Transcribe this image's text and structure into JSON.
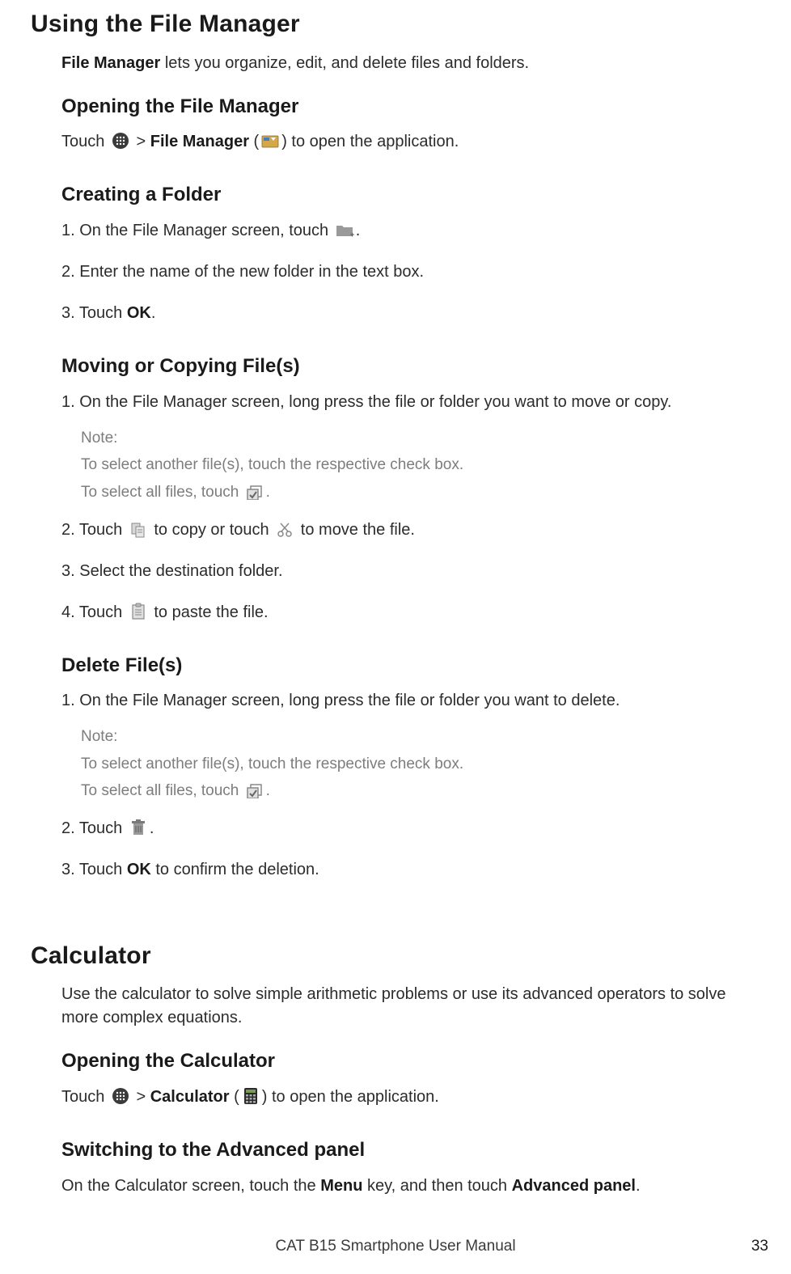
{
  "headings": {
    "using_file_manager": "Using the File Manager",
    "opening_file_manager": "Opening the File Manager",
    "creating_folder": "Creating a Folder",
    "moving_copying": "Moving or Copying File(s)",
    "delete_files": "Delete File(s)",
    "calculator": "Calculator",
    "opening_calculator": "Opening the Calculator",
    "switching_advanced": "Switching to the Advanced panel"
  },
  "text": {
    "fm_intro_1": "File Manager",
    "fm_intro_2": " lets you organize, edit, and delete files and folders.",
    "open_fm_1": "Touch ",
    "open_fm_2": " > ",
    "open_fm_3": "File Manager",
    "open_fm_4": " (",
    "open_fm_5": ") to open the application.",
    "create_step1_a": "1. On the File Manager screen, touch ",
    "create_step1_b": ".",
    "create_step2": "2. Enter the name of the new folder in the text box.",
    "create_step3_a": "3. Touch ",
    "create_step3_b": "OK",
    "create_step3_c": ".",
    "move_step1": "1. On the File Manager screen, long press the file or folder you want to move or copy.",
    "note_label": "Note:",
    "note_line1": "To select another file(s), touch the respective check box.",
    "note_line2_a": "To select all files, touch ",
    "note_line2_b": ".",
    "move_step2_a": "2. Touch ",
    "move_step2_b": " to copy or touch ",
    "move_step2_c": " to move the file.",
    "move_step3": "3. Select the destination folder.",
    "move_step4_a": "4. Touch ",
    "move_step4_b": " to paste the file.",
    "delete_step1": "1. On the File Manager screen, long press the file or folder you want to delete.",
    "delete_step2_a": "2. Touch ",
    "delete_step2_b": ".",
    "delete_step3_a": "3. Touch ",
    "delete_step3_b": "OK",
    "delete_step3_c": " to confirm the deletion.",
    "calc_intro": "Use the calculator to solve simple arithmetic problems or use its advanced operators to solve more complex equations.",
    "open_calc_1": "Touch ",
    "open_calc_2": " > ",
    "open_calc_3": "Calculator",
    "open_calc_4": " (",
    "open_calc_5": ") to open the application.",
    "switch_adv_a": "On the Calculator screen, touch the ",
    "switch_adv_b": "Menu",
    "switch_adv_c": " key, and then touch ",
    "switch_adv_d": "Advanced panel",
    "switch_adv_e": "."
  },
  "footer": {
    "title": "CAT B15 Smartphone User Manual",
    "page": "33"
  }
}
